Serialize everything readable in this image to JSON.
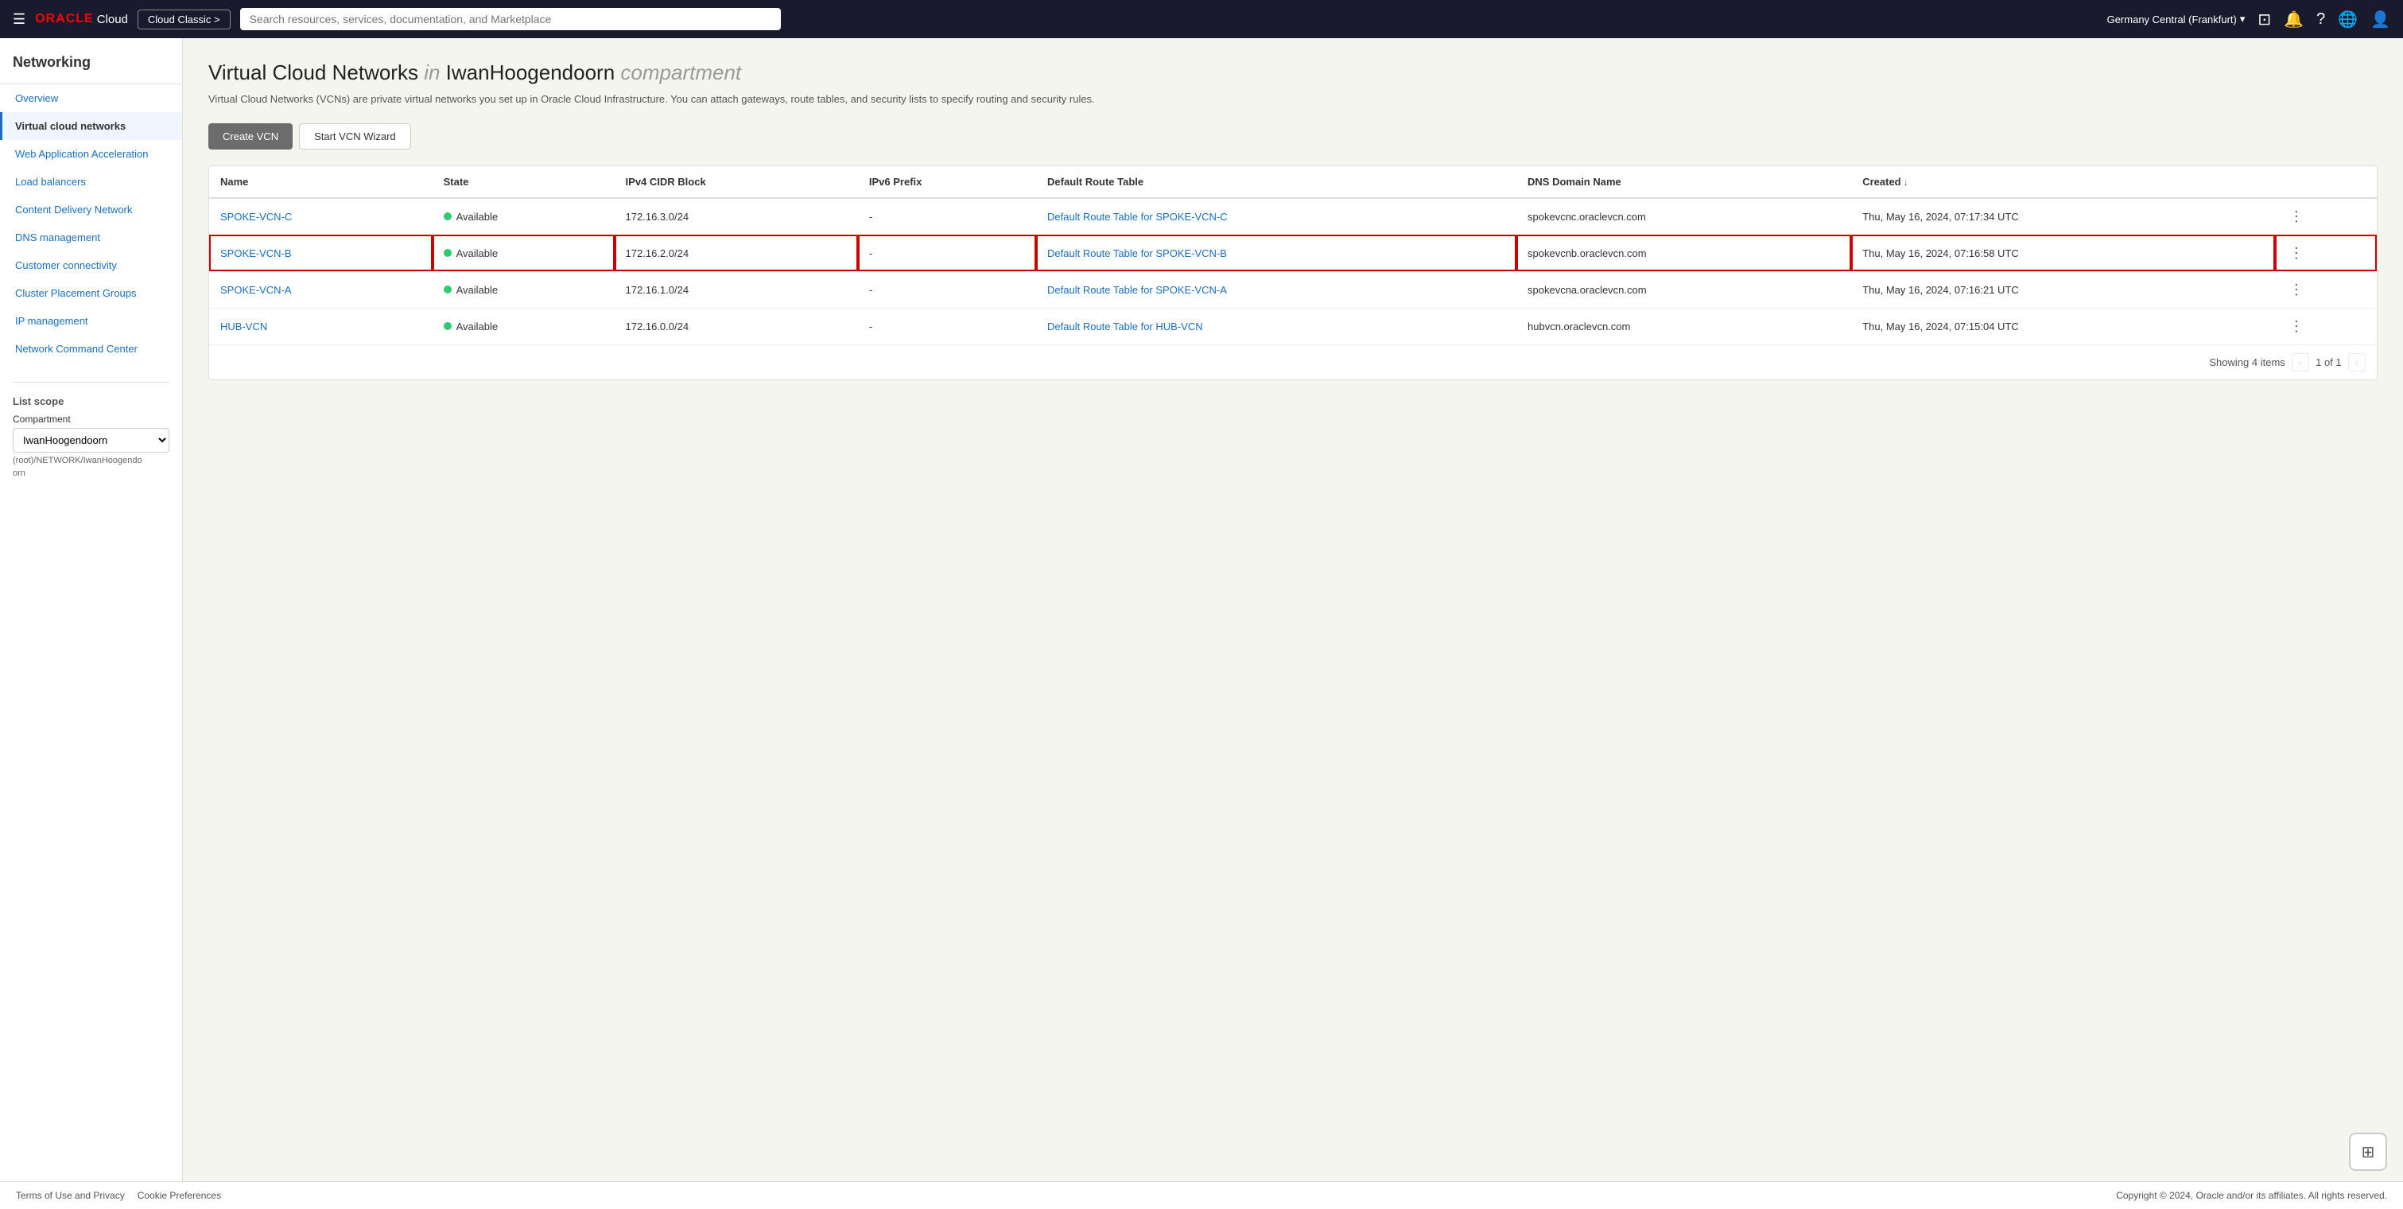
{
  "topnav": {
    "hamburger_icon": "☰",
    "oracle_text": "ORACLE",
    "cloud_text": "Cloud",
    "cloud_classic_label": "Cloud Classic >",
    "search_placeholder": "Search resources, services, documentation, and Marketplace",
    "region_label": "Germany Central (Frankfurt)",
    "chevron_down": "▾",
    "terminal_icon": "⊡",
    "bell_icon": "🔔",
    "help_icon": "?",
    "globe_icon": "🌐",
    "user_icon": "👤"
  },
  "sidebar": {
    "title": "Networking",
    "items": [
      {
        "id": "overview",
        "label": "Overview",
        "active": false
      },
      {
        "id": "virtual-cloud-networks",
        "label": "Virtual cloud networks",
        "active": true
      },
      {
        "id": "web-app-acceleration",
        "label": "Web Application Acceleration",
        "active": false
      },
      {
        "id": "load-balancers",
        "label": "Load balancers",
        "active": false
      },
      {
        "id": "content-delivery-network",
        "label": "Content Delivery Network",
        "active": false
      },
      {
        "id": "dns-management",
        "label": "DNS management",
        "active": false
      },
      {
        "id": "customer-connectivity",
        "label": "Customer connectivity",
        "active": false
      },
      {
        "id": "cluster-placement-groups",
        "label": "Cluster Placement Groups",
        "active": false
      },
      {
        "id": "ip-management",
        "label": "IP management",
        "active": false
      },
      {
        "id": "network-command-center",
        "label": "Network Command Center",
        "active": false
      }
    ]
  },
  "list_scope": {
    "title": "List scope",
    "compartment_label": "Compartment",
    "compartment_value": "IwanHoogendoorn",
    "compartment_path": "(root)/NETWORK/IwanHoogendo",
    "compartment_path2": "orn"
  },
  "page": {
    "title_prefix": "Virtual Cloud Networks",
    "title_in": "in",
    "title_compartment": "IwanHoogendoorn",
    "title_suffix": "compartment",
    "description": "Virtual Cloud Networks (VCNs) are private virtual networks you set up in Oracle Cloud Infrastructure. You can attach gateways, route tables, and security lists to specify routing and security rules.",
    "create_btn": "Create VCN",
    "wizard_btn": "Start VCN Wizard"
  },
  "table": {
    "columns": [
      {
        "id": "name",
        "label": "Name",
        "sortable": false
      },
      {
        "id": "state",
        "label": "State",
        "sortable": false
      },
      {
        "id": "ipv4",
        "label": "IPv4 CIDR Block",
        "sortable": false
      },
      {
        "id": "ipv6",
        "label": "IPv6 Prefix",
        "sortable": false
      },
      {
        "id": "route_table",
        "label": "Default Route Table",
        "sortable": false
      },
      {
        "id": "dns",
        "label": "DNS Domain Name",
        "sortable": false
      },
      {
        "id": "created",
        "label": "Created",
        "sortable": true
      }
    ],
    "rows": [
      {
        "name": "SPOKE-VCN-C",
        "state": "Available",
        "ipv4": "172.16.3.0/24",
        "ipv6": "-",
        "route_table": "Default Route Table for SPOKE-VCN-C",
        "dns": "spokevcnc.oraclevcn.com",
        "created": "Thu, May 16, 2024, 07:17:34 UTC",
        "highlighted": false
      },
      {
        "name": "SPOKE-VCN-B",
        "state": "Available",
        "ipv4": "172.16.2.0/24",
        "ipv6": "-",
        "route_table": "Default Route Table for SPOKE-VCN-B",
        "dns": "spokevcnb.oraclevcn.com",
        "created": "Thu, May 16, 2024, 07:16:58 UTC",
        "highlighted": true
      },
      {
        "name": "SPOKE-VCN-A",
        "state": "Available",
        "ipv4": "172.16.1.0/24",
        "ipv6": "-",
        "route_table": "Default Route Table for SPOKE-VCN-A",
        "dns": "spokevcna.oraclevcn.com",
        "created": "Thu, May 16, 2024, 07:16:21 UTC",
        "highlighted": false
      },
      {
        "name": "HUB-VCN",
        "state": "Available",
        "ipv4": "172.16.0.0/24",
        "ipv6": "-",
        "route_table": "Default Route Table for HUB-VCN",
        "dns": "hubvcn.oraclevcn.com",
        "created": "Thu, May 16, 2024, 07:15:04 UTC",
        "highlighted": false
      }
    ],
    "showing_text": "Showing 4 items",
    "pagination": "1 of 1"
  },
  "footer": {
    "terms_label": "Terms of Use and Privacy",
    "cookie_label": "Cookie Preferences",
    "copyright": "Copyright © 2024, Oracle and/or its affiliates. All rights reserved."
  },
  "help_fab_icon": "⊞"
}
